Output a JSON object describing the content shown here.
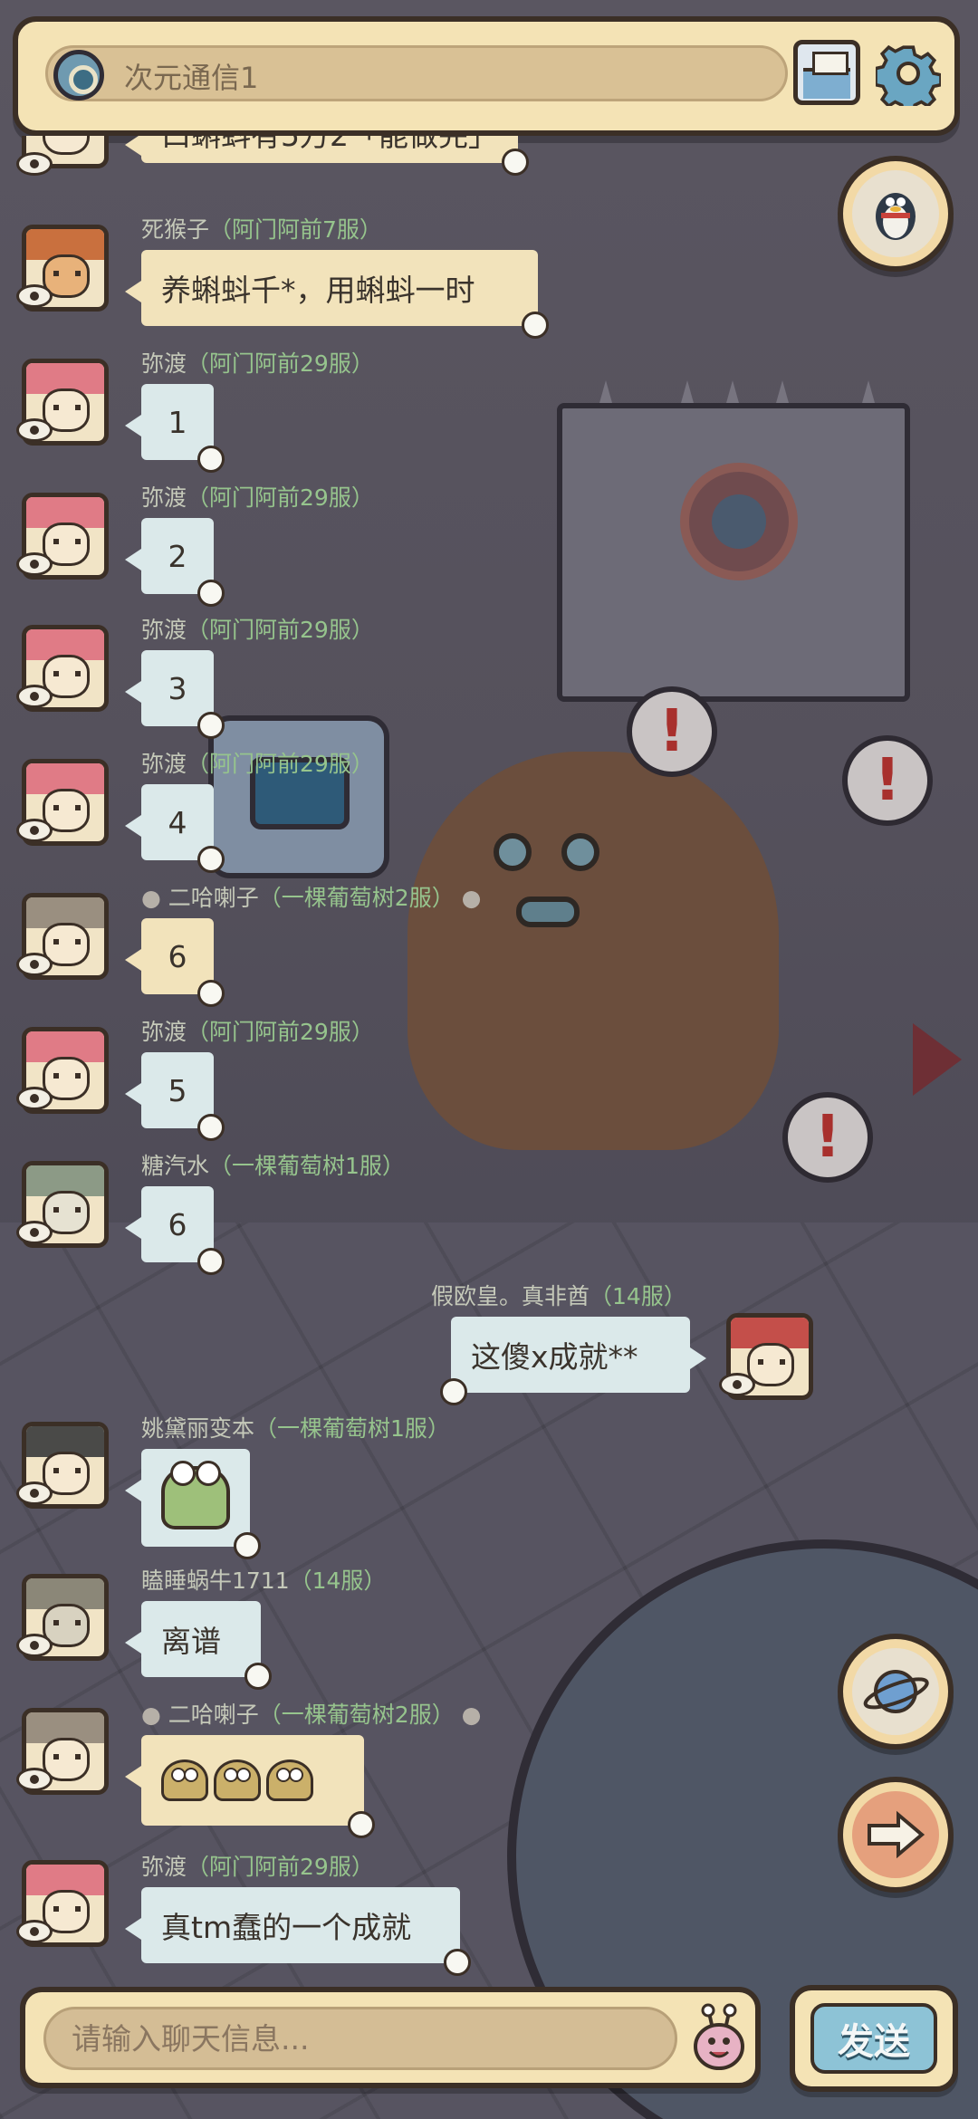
{
  "header": {
    "channel_name": "次元通信1",
    "mail_icon": "envelope-icon",
    "settings_icon": "gear-icon"
  },
  "side_buttons": {
    "qq_icon": "penguin-icon",
    "planet_icon": "planet-icon",
    "next_icon": "arrow-right-icon"
  },
  "partial_top_message": {
    "text": "口蝌蚪有5万2「能做完」"
  },
  "messages": [
    {
      "name": "死猴子",
      "server": "（阿门阿前7服）",
      "text": "养蝌蚪千*，用蝌蚪一时",
      "style": "tan"
    },
    {
      "name": "弥渡",
      "server": "（阿门阿前29服）",
      "text": "1",
      "style": "blue"
    },
    {
      "name": "弥渡",
      "server": "（阿门阿前29服）",
      "text": "2",
      "style": "blue"
    },
    {
      "name": "弥渡",
      "server": "（阿门阿前29服）",
      "text": "3",
      "style": "blue"
    },
    {
      "name": "弥渡",
      "server": "（阿门阿前29服）",
      "text": "4",
      "style": "blue"
    },
    {
      "name": "二哈喇子",
      "server": "（一棵葡萄树2服）",
      "text": "6",
      "style": "tan"
    },
    {
      "name": "弥渡",
      "server": "（阿门阿前29服）",
      "text": "5",
      "style": "blue"
    },
    {
      "name": "糖汽水",
      "server": "（一棵葡萄树1服）",
      "text": "6",
      "style": "blue"
    },
    {
      "name": "假欧皇。真非酋",
      "server": "（14服）",
      "text": "这傻x成就**",
      "style": "blue"
    },
    {
      "name": "姚黛丽变本",
      "server": "（一棵葡萄树1服）",
      "text": "",
      "style": "blue"
    },
    {
      "name": "瞌睡蜗牛1711",
      "server": "（14服）",
      "text": "离谱",
      "style": "blue"
    },
    {
      "name": "二哈喇子",
      "server": "（一棵葡萄树2服）",
      "text": "",
      "style": "tan"
    },
    {
      "name": "弥渡",
      "server": "（阿门阿前29服）",
      "text": "真tm蠢的一个成就",
      "style": "blue"
    }
  ],
  "input": {
    "placeholder": "请输入聊天信息...",
    "value": "",
    "emoji_icon": "snail-face-icon",
    "send_label": "发送"
  }
}
